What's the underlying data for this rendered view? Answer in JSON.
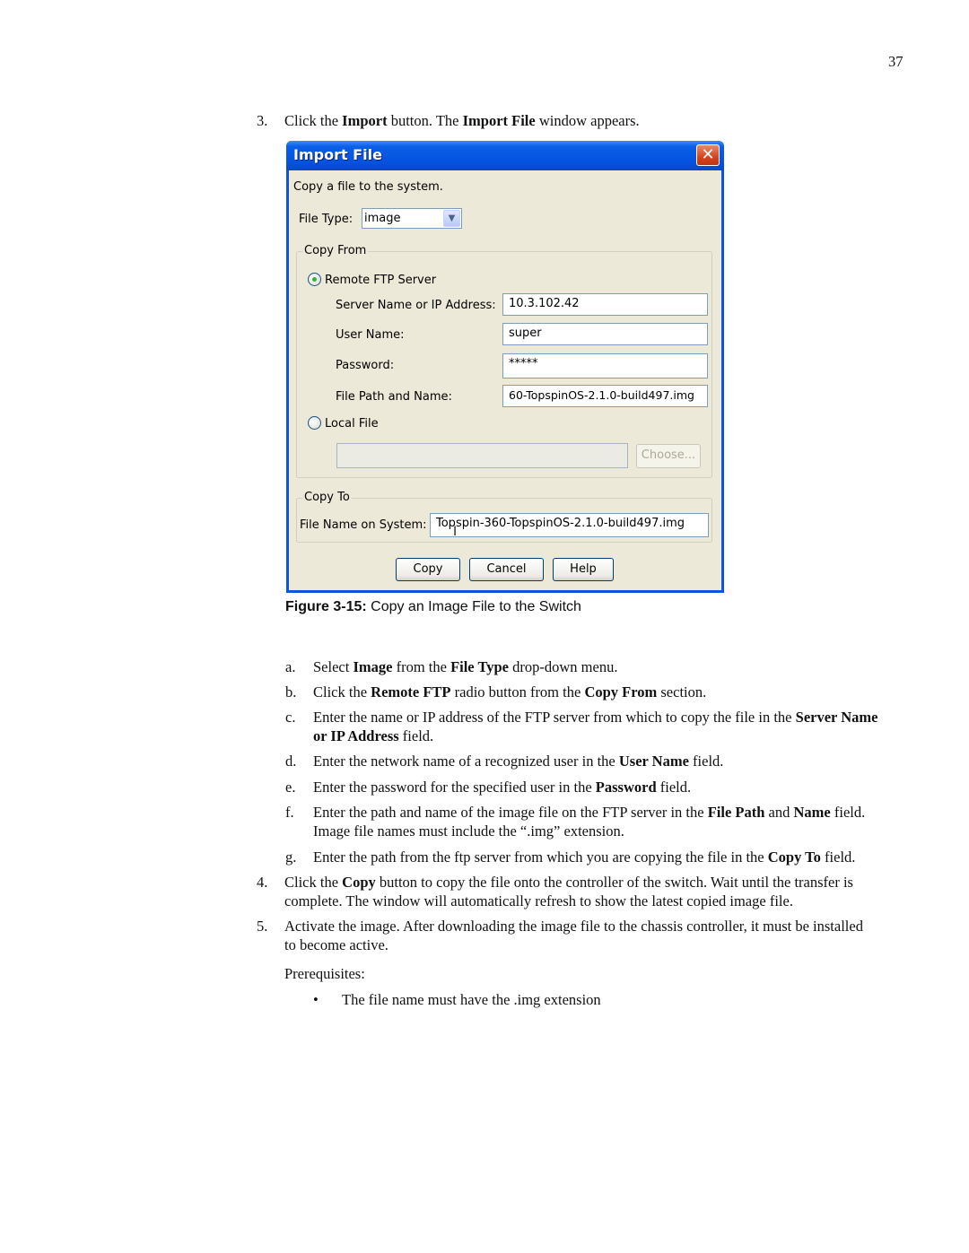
{
  "page": {
    "number": "37"
  },
  "step3": {
    "num": "3.",
    "pre": "Click the ",
    "b1": "Import",
    "mid": " button. The ",
    "b2": "Import File",
    "post": " window appears."
  },
  "dialog": {
    "title": "Import File",
    "close_label": "✕",
    "intro": "Copy a file to the system.",
    "file_type_label": "File Type:",
    "file_type_value": "image",
    "copy_from": {
      "legend": "Copy From",
      "remote_label": "Remote FTP Server",
      "remote_selected": true,
      "server_label": "Server Name or IP Address:",
      "server_value": "10.3.102.42",
      "user_label": "User Name:",
      "user_value": "super",
      "password_label": "Password:",
      "password_value": "*****",
      "path_label": "File Path and Name:",
      "path_value": "60-TopspinOS-2.1.0-build497.img",
      "local_label": "Local File",
      "local_selected": false,
      "local_value": "",
      "choose_label": "Choose..."
    },
    "copy_to": {
      "legend": "Copy To",
      "name_label": "File Name on System:",
      "name_value": "Topspin-360-TopspinOS-2.1.0-build497.img"
    },
    "buttons": {
      "copy": "Copy",
      "cancel": "Cancel",
      "help": "Help"
    }
  },
  "figure": {
    "label": "Figure 3-15:",
    "caption": " Copy an Image File to the Switch"
  },
  "substeps": [
    {
      "num": "a.",
      "parts": [
        "Select ",
        "Image",
        " from the ",
        "File Type",
        " drop-down menu."
      ]
    },
    {
      "num": "b.",
      "parts": [
        "Click the ",
        "Remote FTP",
        " radio button from the ",
        "Copy From",
        " section."
      ]
    },
    {
      "num": "c.",
      "line1": [
        "Enter the name or IP address of the FTP server from which to copy the file in the ",
        "Server Name"
      ],
      "line2": [
        "or IP Address",
        " field."
      ]
    },
    {
      "num": "d.",
      "parts": [
        "Enter the network name of a recognized user in the ",
        "User Name",
        " field."
      ]
    },
    {
      "num": "e.",
      "parts": [
        "Enter the password for the specified user in the ",
        "Password",
        " field."
      ]
    },
    {
      "num": "f.",
      "line1": [
        "Enter the path and name of the image file on the FTP server in the ",
        "File Path",
        " and ",
        "Name",
        " field."
      ],
      "line2": "Image file names must include the “.img” extension."
    },
    {
      "num": "g.",
      "parts": [
        "Enter the path from the ftp server from which you are copying the file in the ",
        "Copy To",
        " field."
      ]
    }
  ],
  "step4": {
    "num": "4.",
    "line1": [
      "Click the ",
      "Copy",
      " button to copy the file onto the controller of the switch. Wait until the transfer is"
    ],
    "line2": "complete. The window will automatically refresh to show the latest copied image file."
  },
  "step5": {
    "num": "5.",
    "line1": "Activate the image. After downloading the image file to the chassis controller, it must be installed",
    "line2": "to become active."
  },
  "prereq": {
    "label": "Prerequisites:",
    "bullet": "•",
    "items": [
      "The file name must have the .img extension"
    ]
  }
}
